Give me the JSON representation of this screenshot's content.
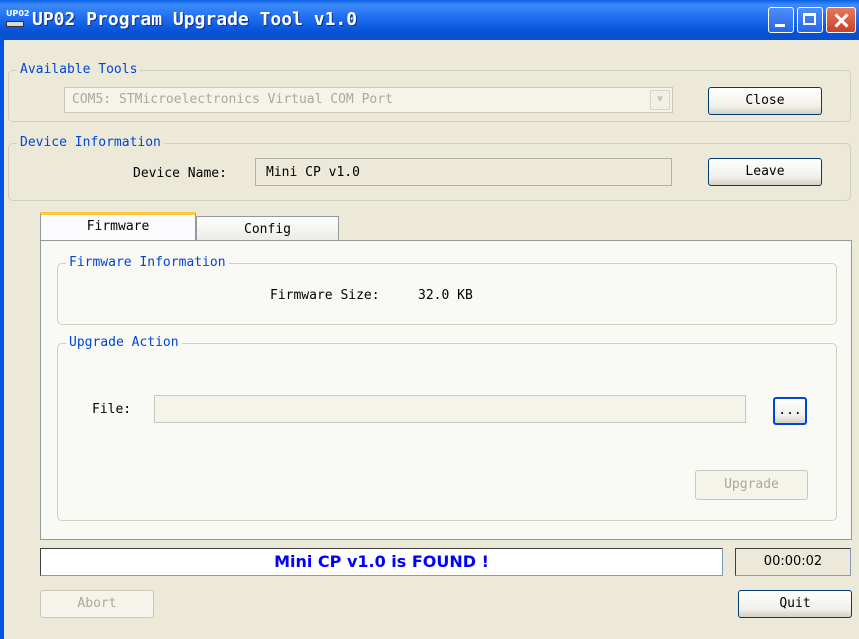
{
  "window": {
    "title": "UP02 Program Upgrade Tool v1.0",
    "icon_label": "UP02"
  },
  "available_tools": {
    "group_label": "Available Tools",
    "combo_value": "COM5: STMicroelectronics Virtual COM Port",
    "close_button": "Close"
  },
  "device_info": {
    "group_label": "Device Information",
    "name_label": "Device Name:",
    "name_value": "Mini CP v1.0",
    "leave_button": "Leave"
  },
  "tabs": [
    {
      "label": "Firmware",
      "active": true
    },
    {
      "label": "Config",
      "active": false
    }
  ],
  "firmware_info": {
    "group_label": "Firmware Information",
    "size_label": "Firmware Size:",
    "size_value": "32.0 KB"
  },
  "upgrade_action": {
    "group_label": "Upgrade Action",
    "file_label": "File:",
    "file_value": "",
    "browse_button": "...",
    "upgrade_button": "Upgrade"
  },
  "status": {
    "message": "Mini CP v1.0  is FOUND !",
    "timer": "00:00:02",
    "message_color": "#0000ff"
  },
  "footer": {
    "abort_button": "Abort",
    "quit_button": "Quit"
  },
  "colors": {
    "titlebar": "#0552d6",
    "window_bg": "#ece9d8",
    "group_label": "#0046d5",
    "tab_highlight": "#ffc83c"
  }
}
